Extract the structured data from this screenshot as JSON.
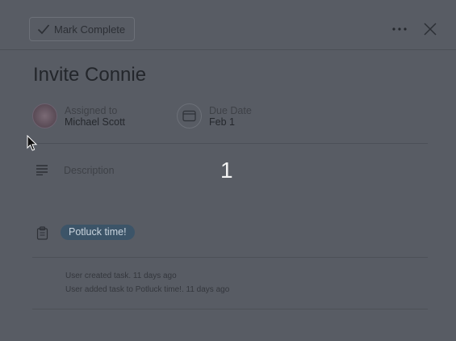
{
  "toolbar": {
    "mark_complete_label": "Mark Complete",
    "more_icon": "ellipsis-icon",
    "close_icon": "close-icon"
  },
  "task": {
    "title": "Invite Connie",
    "assignee_label": "Assigned to",
    "assignee_name": "Michael Scott",
    "due_label": "Due Date",
    "due_value": "Feb 1",
    "description_placeholder": "Description",
    "project_tag": "Potluck time!"
  },
  "overlay": {
    "number": "1"
  },
  "activity": [
    "User created task. 11 days ago",
    "User added task to Potluck time!. 11 days ago"
  ],
  "colors": {
    "background": "#585c64",
    "tag_bg": "#3c5468",
    "overlay_text": "#f2f2f2"
  }
}
